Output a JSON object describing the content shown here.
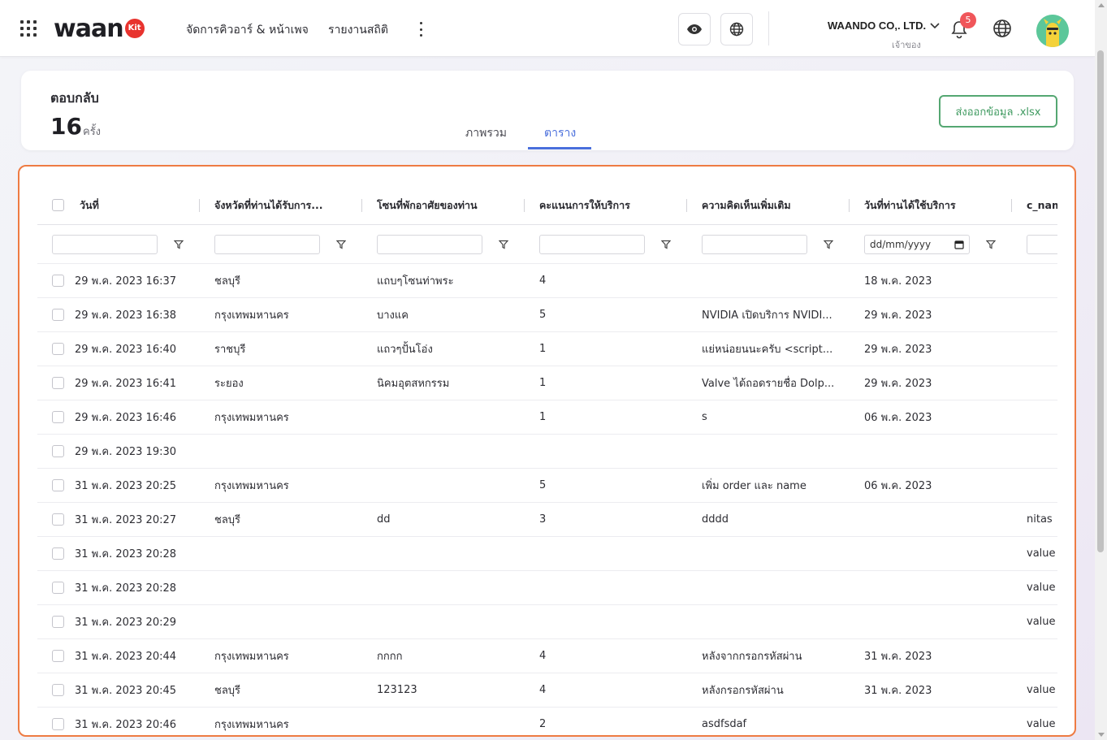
{
  "header": {
    "logo_text": "waan",
    "logo_kit": "Kit",
    "nav": [
      "จัดการคิวอาร์ & หน้าเพจ",
      "รายงานสถิติ"
    ],
    "company_name": "WAANDO CO,. LTD.",
    "company_role": "เจ้าของ",
    "notification_count": "5",
    "icons": {
      "apps": "apps-grid-icon",
      "more": "kebab-menu-icon",
      "preview": "eye-icon",
      "web": "globe-icon",
      "notifications": "bell-icon",
      "language": "globe-icon"
    }
  },
  "summary": {
    "title": "ตอบกลับ",
    "count": "16",
    "unit": "ครั้ง",
    "tabs": [
      "ภาพรวม",
      "ตาราง"
    ],
    "active_tab": "ตาราง",
    "export_label": "ส่งออกข้อมูล .xlsx"
  },
  "table": {
    "columns": [
      "วันที่",
      "จังหวัดที่ท่านได้รับการ...",
      "โซนที่พักอาศัยของท่าน",
      "คะแนนการให้บริการ",
      "ความคิดเห็นเพิ่มเติม",
      "วันที่ท่านได้ใช้บริการ",
      "c_nam"
    ],
    "date_filter_placeholder": "dd/mm/yyyy",
    "rows": [
      [
        "29 พ.ค. 2023 16:37",
        "ชลบุรี",
        "แถบๆโซนท่าพระ",
        "4",
        "",
        "18 พ.ค. 2023",
        ""
      ],
      [
        "29 พ.ค. 2023 16:38",
        "กรุงเทพมหานคร",
        "บางแค",
        "5",
        "NVIDIA เปิดบริการ NVIDI...",
        "29 พ.ค. 2023",
        ""
      ],
      [
        "29 พ.ค. 2023 16:40",
        "ราชบุรี",
        "แถวๆปั้นโอ่ง",
        "1",
        "แย่หน่อยนนะครับ <script...",
        "29 พ.ค. 2023",
        ""
      ],
      [
        "29 พ.ค. 2023 16:41",
        "ระยอง",
        "นิคมอุตสหกรรม",
        "1",
        "Valve ได้ถอดรายชื่อ Dolp...",
        "29 พ.ค. 2023",
        ""
      ],
      [
        "29 พ.ค. 2023 16:46",
        "กรุงเทพมหานคร",
        "",
        "1",
        "s",
        "06 พ.ค. 2023",
        ""
      ],
      [
        "29 พ.ค. 2023 19:30",
        "",
        "",
        "",
        "",
        "",
        ""
      ],
      [
        "31 พ.ค. 2023 20:25",
        "กรุงเทพมหานคร",
        "",
        "5",
        "เพิ่ม order และ name",
        "06 พ.ค. 2023",
        ""
      ],
      [
        "31 พ.ค. 2023 20:27",
        "ชลบุรี",
        "dd",
        "3",
        "dddd",
        "",
        "nitas"
      ],
      [
        "31 พ.ค. 2023 20:28",
        "",
        "",
        "",
        "",
        "",
        "value"
      ],
      [
        "31 พ.ค. 2023 20:28",
        "",
        "",
        "",
        "",
        "",
        "value"
      ],
      [
        "31 พ.ค. 2023 20:29",
        "",
        "",
        "",
        "",
        "",
        "value"
      ],
      [
        "31 พ.ค. 2023 20:44",
        "กรุงเทพมหานคร",
        "กกกก",
        "4",
        "หลังจากกรอกรหัสผ่าน",
        "31 พ.ค. 2023",
        ""
      ],
      [
        "31 พ.ค. 2023 20:45",
        "ชลบุรี",
        "123123",
        "4",
        "หลังกรอกรหัสผ่าน",
        "31 พ.ค. 2023",
        "value"
      ],
      [
        "31 พ.ค. 2023 20:46",
        "กรุงเทพมหานคร",
        "",
        "2",
        "asdfsdaf",
        "",
        "value"
      ]
    ]
  },
  "colors": {
    "accent": "#4a6fdc",
    "export_green": "#3f9a60",
    "panel_border": "#ee7b43",
    "badge": "#f0565a"
  }
}
